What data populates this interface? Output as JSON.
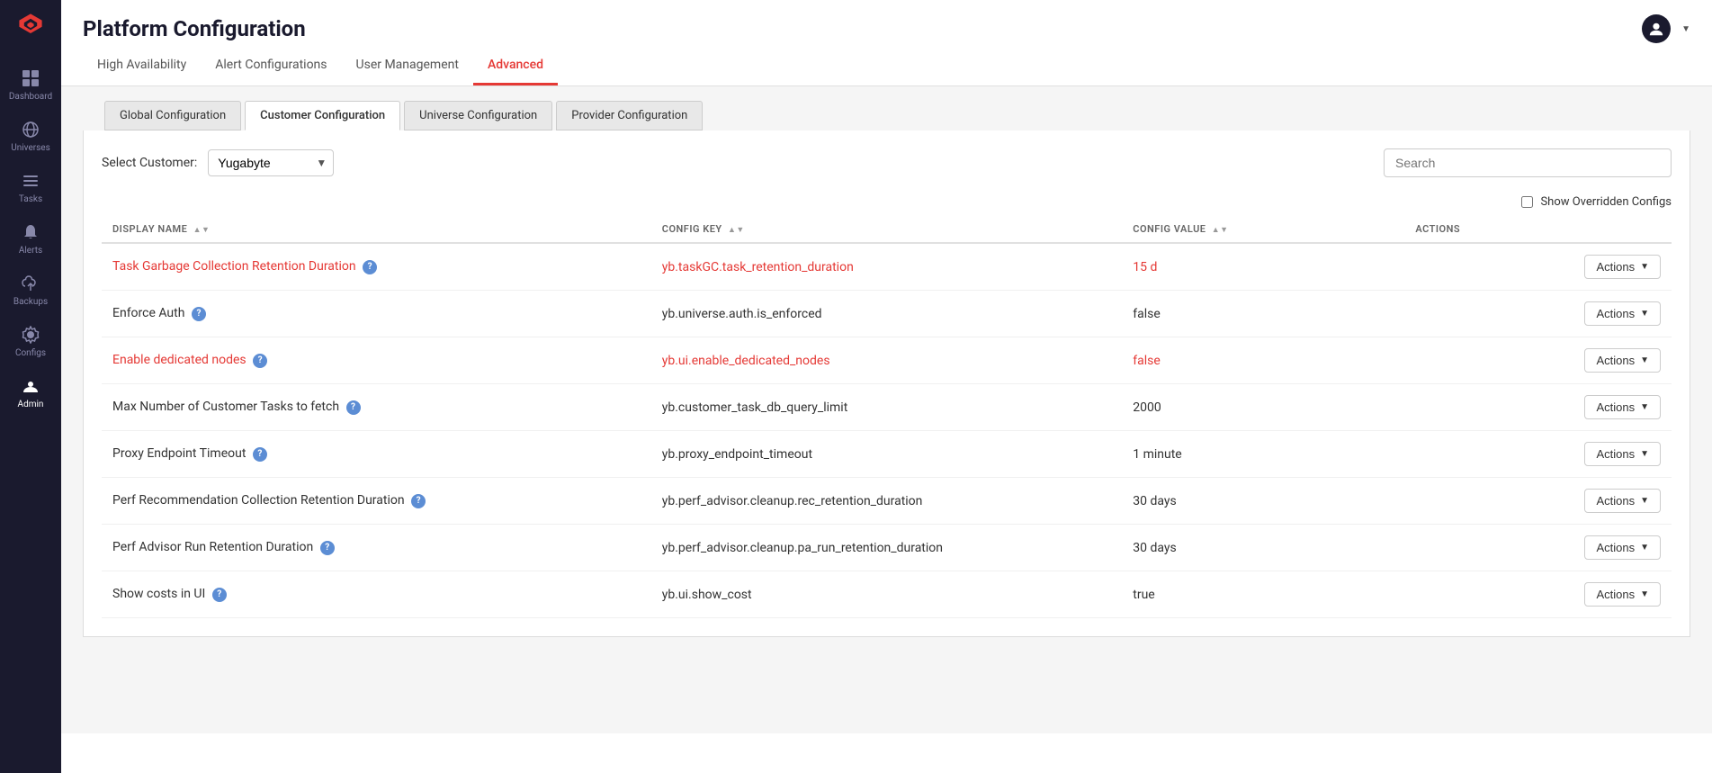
{
  "page": {
    "title": "Platform Configuration"
  },
  "sidebar": {
    "items": [
      {
        "id": "dashboard",
        "label": "Dashboard",
        "icon": "⊞",
        "active": false
      },
      {
        "id": "universes",
        "label": "Universes",
        "icon": "🌐",
        "active": false
      },
      {
        "id": "tasks",
        "label": "Tasks",
        "icon": "☰",
        "active": false
      },
      {
        "id": "alerts",
        "label": "Alerts",
        "icon": "🔔",
        "active": false
      },
      {
        "id": "backups",
        "label": "Backups",
        "icon": "☁",
        "active": false
      },
      {
        "id": "configs",
        "label": "Configs",
        "icon": "⚙",
        "active": false
      },
      {
        "id": "admin",
        "label": "Admin",
        "icon": "⚙",
        "active": true
      }
    ]
  },
  "tabs": [
    {
      "id": "high-availability",
      "label": "High Availability",
      "active": false
    },
    {
      "id": "alert-configurations",
      "label": "Alert Configurations",
      "active": false
    },
    {
      "id": "user-management",
      "label": "User Management",
      "active": false
    },
    {
      "id": "advanced",
      "label": "Advanced",
      "active": true
    }
  ],
  "sub_tabs": [
    {
      "id": "global-configuration",
      "label": "Global Configuration",
      "active": false
    },
    {
      "id": "customer-configuration",
      "label": "Customer Configuration",
      "active": true
    },
    {
      "id": "universe-configuration",
      "label": "Universe Configuration",
      "active": false
    },
    {
      "id": "provider-configuration",
      "label": "Provider Configuration",
      "active": false
    }
  ],
  "filter": {
    "customer_label": "Select Customer:",
    "customer_value": "Yugabyte",
    "customer_options": [
      "Yugabyte"
    ],
    "search_placeholder": "Search",
    "show_overridden_label": "Show Overridden Configs"
  },
  "table": {
    "headers": {
      "display_name": "DISPLAY NAME",
      "config_key": "CONFIG KEY",
      "config_value": "CONFIG VALUE",
      "actions": "ACTIONS"
    },
    "rows": [
      {
        "display_name": "Task Garbage Collection Retention Duration",
        "is_overridden": true,
        "has_help": true,
        "config_key": "yb.taskGC.task_retention_duration",
        "config_value": "15 d",
        "value_overridden": true,
        "actions_label": "Actions"
      },
      {
        "display_name": "Enforce Auth",
        "is_overridden": false,
        "has_help": true,
        "config_key": "yb.universe.auth.is_enforced",
        "config_value": "false",
        "value_overridden": false,
        "actions_label": "Actions"
      },
      {
        "display_name": "Enable dedicated nodes",
        "is_overridden": true,
        "has_help": true,
        "config_key": "yb.ui.enable_dedicated_nodes",
        "config_value": "false",
        "value_overridden": true,
        "actions_label": "Actions"
      },
      {
        "display_name": "Max Number of Customer Tasks to fetch",
        "is_overridden": false,
        "has_help": true,
        "config_key": "yb.customer_task_db_query_limit",
        "config_value": "2000",
        "value_overridden": false,
        "actions_label": "Actions"
      },
      {
        "display_name": "Proxy Endpoint Timeout",
        "is_overridden": false,
        "has_help": true,
        "config_key": "yb.proxy_endpoint_timeout",
        "config_value": "1 minute",
        "value_overridden": false,
        "actions_label": "Actions"
      },
      {
        "display_name": "Perf Recommendation Collection Retention Duration",
        "is_overridden": false,
        "has_help": true,
        "config_key": "yb.perf_advisor.cleanup.rec_retention_duration",
        "config_value": "30 days",
        "value_overridden": false,
        "actions_label": "Actions"
      },
      {
        "display_name": "Perf Advisor Run Retention Duration",
        "is_overridden": false,
        "has_help": true,
        "config_key": "yb.perf_advisor.cleanup.pa_run_retention_duration",
        "config_value": "30 days",
        "value_overridden": false,
        "actions_label": "Actions"
      },
      {
        "display_name": "Show costs in UI",
        "is_overridden": false,
        "has_help": true,
        "config_key": "yb.ui.show_cost",
        "config_value": "true",
        "value_overridden": false,
        "actions_label": "Actions"
      }
    ]
  },
  "colors": {
    "accent_red": "#e53935",
    "overridden_color": "#e53935",
    "sidebar_bg": "#1a1a2e",
    "help_icon_bg": "#5c8dd4"
  }
}
